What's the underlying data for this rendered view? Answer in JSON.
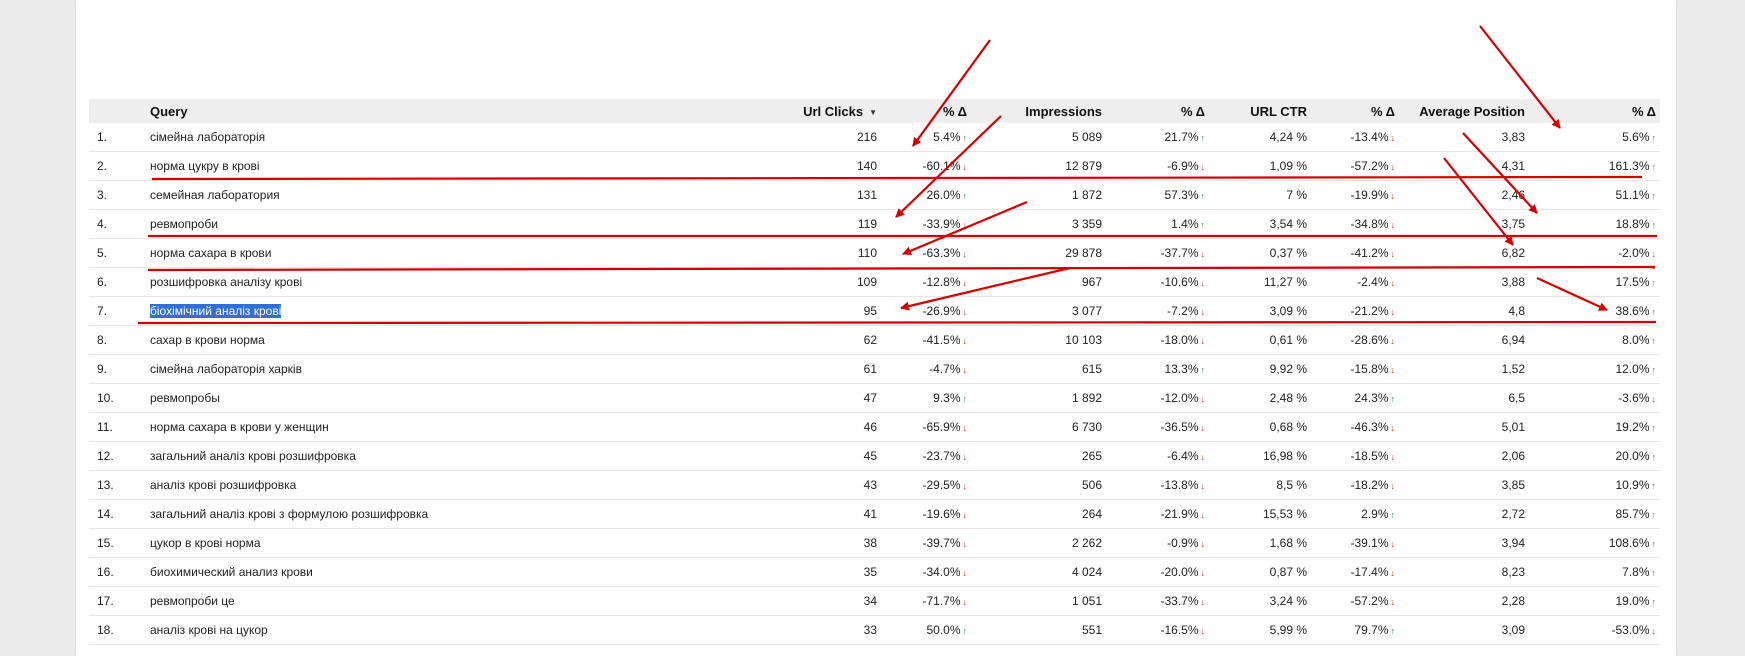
{
  "colors": {
    "annotation": "#d40000",
    "up": "#1e8e3e",
    "down": "#d93025",
    "header_bg": "#eeeeee",
    "selection": "#2f6fd6"
  },
  "table": {
    "headers": {
      "query": "Query",
      "url_clicks": "Url Clicks",
      "clicks_delta": "% Δ",
      "impressions": "Impressions",
      "impressions_delta": "% Δ",
      "url_ctr": "URL CTR",
      "ctr_delta": "% Δ",
      "avg_position": "Average Position",
      "position_delta": "% Δ"
    },
    "sort_icon": "sort-desc-icon",
    "rows": [
      {
        "num": "1.",
        "query": "сімейна лабораторія",
        "clicks": "216",
        "clicks_d": "5.4%",
        "clicks_dir": "up",
        "impr": "5 089",
        "impr_d": "21.7%",
        "impr_dir": "up",
        "ctr": "4,24 %",
        "ctr_d": "-13.4%",
        "ctr_dir": "down",
        "pos": "3,83",
        "pos_d": "5.6%",
        "pos_dir": "up"
      },
      {
        "num": "2.",
        "query": "норма цукру в крові",
        "clicks": "140",
        "clicks_d": "-60.1%",
        "clicks_dir": "down",
        "impr": "12 879",
        "impr_d": "-6.9%",
        "impr_dir": "down",
        "ctr": "1,09 %",
        "ctr_d": "-57.2%",
        "ctr_dir": "down",
        "pos": "4,31",
        "pos_d": "161.3%",
        "pos_dir": "up"
      },
      {
        "num": "3.",
        "query": "семейная лаборатория",
        "clicks": "131",
        "clicks_d": "26.0%",
        "clicks_dir": "up",
        "impr": "1 872",
        "impr_d": "57.3%",
        "impr_dir": "up",
        "ctr": "7 %",
        "ctr_d": "-19.9%",
        "ctr_dir": "down",
        "pos": "2,46",
        "pos_d": "51.1%",
        "pos_dir": "up"
      },
      {
        "num": "4.",
        "query": "ревмопроби",
        "clicks": "119",
        "clicks_d": "-33.9%",
        "clicks_dir": "down",
        "impr": "3 359",
        "impr_d": "1.4%",
        "impr_dir": "up",
        "ctr": "3,54 %",
        "ctr_d": "-34.8%",
        "ctr_dir": "down",
        "pos": "3,75",
        "pos_d": "18.8%",
        "pos_dir": "up"
      },
      {
        "num": "5.",
        "query": "норма сахара в крови",
        "clicks": "110",
        "clicks_d": "-63.3%",
        "clicks_dir": "down",
        "impr": "29 878",
        "impr_d": "-37.7%",
        "impr_dir": "down",
        "ctr": "0,37 %",
        "ctr_d": "-41.2%",
        "ctr_dir": "down",
        "pos": "6,82",
        "pos_d": "-2.0%",
        "pos_dir": "down"
      },
      {
        "num": "6.",
        "query": "розшифровка аналізу крові",
        "clicks": "109",
        "clicks_d": "-12.8%",
        "clicks_dir": "down",
        "impr": "967",
        "impr_d": "-10.6%",
        "impr_dir": "down",
        "ctr": "11,27 %",
        "ctr_d": "-2.4%",
        "ctr_dir": "down",
        "pos": "3,88",
        "pos_d": "17.5%",
        "pos_dir": "up"
      },
      {
        "num": "7.",
        "query": "біохімічний аналіз крові",
        "clicks": "95",
        "clicks_d": "-26.9%",
        "clicks_dir": "down",
        "impr": "3 077",
        "impr_d": "-7.2%",
        "impr_dir": "down",
        "ctr": "3,09 %",
        "ctr_d": "-21.2%",
        "ctr_dir": "down",
        "pos": "4,8",
        "pos_d": "38.6%",
        "pos_dir": "up",
        "selected": true
      },
      {
        "num": "8.",
        "query": "сахар в крови норма",
        "clicks": "62",
        "clicks_d": "-41.5%",
        "clicks_dir": "down",
        "impr": "10 103",
        "impr_d": "-18.0%",
        "impr_dir": "down",
        "ctr": "0,61 %",
        "ctr_d": "-28.6%",
        "ctr_dir": "down",
        "pos": "6,94",
        "pos_d": "8.0%",
        "pos_dir": "up"
      },
      {
        "num": "9.",
        "query": "сімейна лабораторія харків",
        "clicks": "61",
        "clicks_d": "-4.7%",
        "clicks_dir": "down",
        "impr": "615",
        "impr_d": "13.3%",
        "impr_dir": "up",
        "ctr": "9,92 %",
        "ctr_d": "-15.8%",
        "ctr_dir": "down",
        "pos": "1,52",
        "pos_d": "12.0%",
        "pos_dir": "up"
      },
      {
        "num": "10.",
        "query": "ревмопробы",
        "clicks": "47",
        "clicks_d": "9.3%",
        "clicks_dir": "up",
        "impr": "1 892",
        "impr_d": "-12.0%",
        "impr_dir": "down",
        "ctr": "2,48 %",
        "ctr_d": "24.3%",
        "ctr_dir": "up",
        "pos": "6,5",
        "pos_d": "-3.6%",
        "pos_dir": "down"
      },
      {
        "num": "11.",
        "query": "норма сахара в крови у женщин",
        "clicks": "46",
        "clicks_d": "-65.9%",
        "clicks_dir": "down",
        "impr": "6 730",
        "impr_d": "-36.5%",
        "impr_dir": "down",
        "ctr": "0,68 %",
        "ctr_d": "-46.3%",
        "ctr_dir": "down",
        "pos": "5,01",
        "pos_d": "19.2%",
        "pos_dir": "up"
      },
      {
        "num": "12.",
        "query": "загальний аналіз крові розшифровка",
        "clicks": "45",
        "clicks_d": "-23.7%",
        "clicks_dir": "down",
        "impr": "265",
        "impr_d": "-6.4%",
        "impr_dir": "down",
        "ctr": "16,98 %",
        "ctr_d": "-18.5%",
        "ctr_dir": "down",
        "pos": "2,06",
        "pos_d": "20.0%",
        "pos_dir": "up"
      },
      {
        "num": "13.",
        "query": "аналіз крові розшифровка",
        "clicks": "43",
        "clicks_d": "-29.5%",
        "clicks_dir": "down",
        "impr": "506",
        "impr_d": "-13.8%",
        "impr_dir": "down",
        "ctr": "8,5 %",
        "ctr_d": "-18.2%",
        "ctr_dir": "down",
        "pos": "3,85",
        "pos_d": "10.9%",
        "pos_dir": "up"
      },
      {
        "num": "14.",
        "query": "загальний аналіз крові з формулою розшифровка",
        "clicks": "41",
        "clicks_d": "-19.6%",
        "clicks_dir": "down",
        "impr": "264",
        "impr_d": "-21.9%",
        "impr_dir": "down",
        "ctr": "15,53 %",
        "ctr_d": "2.9%",
        "ctr_dir": "up",
        "pos": "2,72",
        "pos_d": "85.7%",
        "pos_dir": "up"
      },
      {
        "num": "15.",
        "query": "цукор в крові норма",
        "clicks": "38",
        "clicks_d": "-39.7%",
        "clicks_dir": "down",
        "impr": "2 262",
        "impr_d": "-0.9%",
        "impr_dir": "down",
        "ctr": "1,68 %",
        "ctr_d": "-39.1%",
        "ctr_dir": "down",
        "pos": "3,94",
        "pos_d": "108.6%",
        "pos_dir": "up"
      },
      {
        "num": "16.",
        "query": "биохимический анализ крови",
        "clicks": "35",
        "clicks_d": "-34.0%",
        "clicks_dir": "down",
        "impr": "4 024",
        "impr_d": "-20.0%",
        "impr_dir": "down",
        "ctr": "0,87 %",
        "ctr_d": "-17.4%",
        "ctr_dir": "down",
        "pos": "8,23",
        "pos_d": "7.8%",
        "pos_dir": "up"
      },
      {
        "num": "17.",
        "query": "ревмопроби це",
        "clicks": "34",
        "clicks_d": "-71.7%",
        "clicks_dir": "down",
        "impr": "1 051",
        "impr_d": "-33.7%",
        "impr_dir": "down",
        "ctr": "3,24 %",
        "ctr_d": "-57.2%",
        "ctr_dir": "down",
        "pos": "2,28",
        "pos_d": "19.0%",
        "pos_dir": "up"
      },
      {
        "num": "18.",
        "query": "аналіз крові на цукор",
        "clicks": "33",
        "clicks_d": "50.0%",
        "clicks_dir": "up",
        "impr": "551",
        "impr_d": "-16.5%",
        "impr_dir": "down",
        "ctr": "5,99 %",
        "ctr_d": "79.7%",
        "ctr_dir": "up",
        "pos": "3,09",
        "pos_d": "-53.0%",
        "pos_dir": "down"
      }
    ]
  }
}
